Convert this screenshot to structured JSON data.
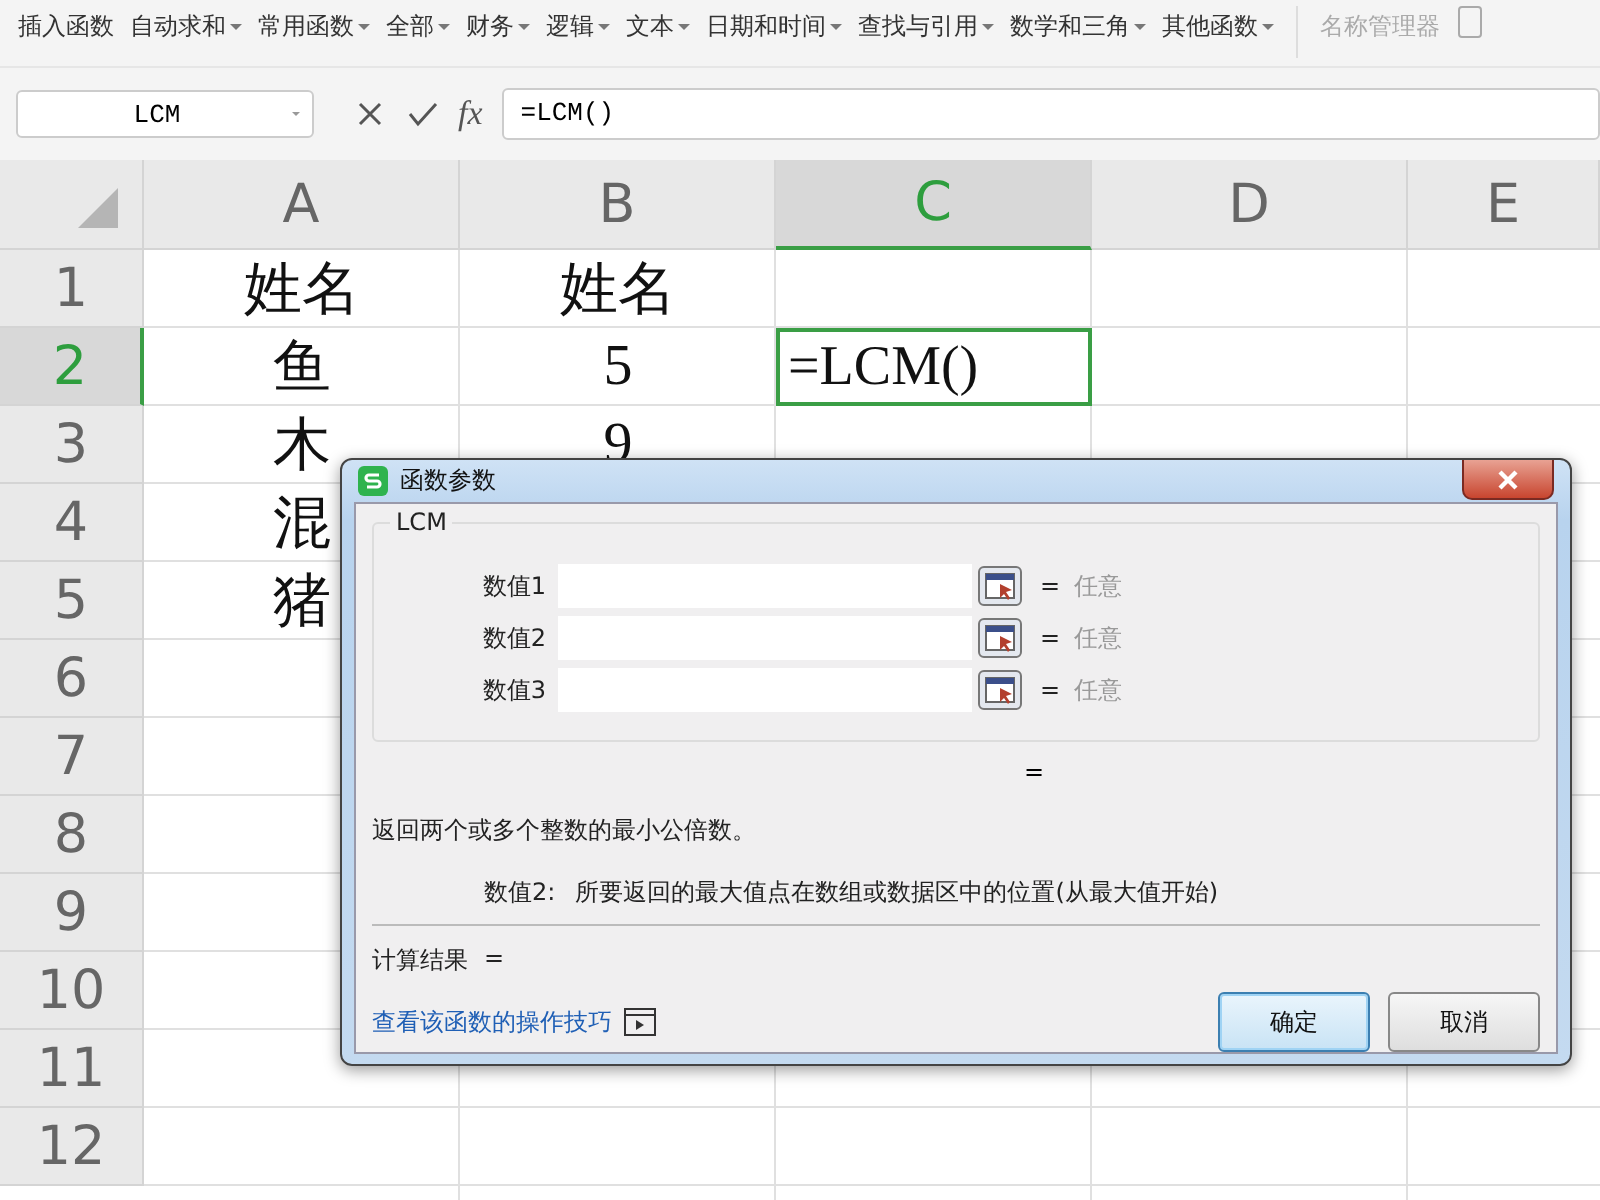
{
  "toolbar": {
    "items": [
      {
        "label": "插入函数",
        "has_menu": false,
        "disabled": false
      },
      {
        "label": "自动求和",
        "has_menu": true,
        "disabled": false
      },
      {
        "label": "常用函数",
        "has_menu": true,
        "disabled": false
      },
      {
        "label": "全部",
        "has_menu": true,
        "disabled": false
      },
      {
        "label": "财务",
        "has_menu": true,
        "disabled": false
      },
      {
        "label": "逻辑",
        "has_menu": true,
        "disabled": false
      },
      {
        "label": "文本",
        "has_menu": true,
        "disabled": false
      },
      {
        "label": "日期和时间",
        "has_menu": true,
        "disabled": false
      },
      {
        "label": "查找与引用",
        "has_menu": true,
        "disabled": false
      },
      {
        "label": "数学和三角",
        "has_menu": true,
        "disabled": false
      },
      {
        "label": "其他函数",
        "has_menu": true,
        "disabled": false
      },
      {
        "label": "名称管理器",
        "has_menu": false,
        "disabled": true
      }
    ]
  },
  "formula_bar": {
    "name_box": "LCM",
    "fx": "fx",
    "formula": "=LCM()"
  },
  "sheet": {
    "columns": [
      {
        "label": "A",
        "selected": false
      },
      {
        "label": "B",
        "selected": false
      },
      {
        "label": "C",
        "selected": true
      },
      {
        "label": "D",
        "selected": false
      },
      {
        "label": "E",
        "selected": false
      }
    ],
    "rows": [
      {
        "label": "1",
        "selected": false,
        "cells": [
          {
            "text": "姓名",
            "kind": "text",
            "selected": false
          },
          {
            "text": "姓名",
            "kind": "text",
            "selected": false
          }
        ]
      },
      {
        "label": "2",
        "selected": true,
        "cells": [
          {
            "text": "鱼",
            "kind": "text",
            "selected": false
          },
          {
            "text": "5",
            "kind": "text",
            "selected": false
          },
          {
            "text": "=LCM()",
            "kind": "formula",
            "selected": true
          }
        ]
      },
      {
        "label": "3",
        "selected": false,
        "cells": [
          {
            "text": "木",
            "kind": "text",
            "selected": false
          },
          {
            "text": "9",
            "kind": "text",
            "selected": false
          }
        ]
      },
      {
        "label": "4",
        "selected": false,
        "cells": [
          {
            "text": "混",
            "kind": "text",
            "selected": false
          }
        ]
      },
      {
        "label": "5",
        "selected": false,
        "cells": [
          {
            "text": "猪",
            "kind": "text",
            "selected": false
          }
        ]
      },
      {
        "label": "6",
        "selected": false
      },
      {
        "label": "7",
        "selected": false
      },
      {
        "label": "8",
        "selected": false
      },
      {
        "label": "9",
        "selected": false
      },
      {
        "label": "10",
        "selected": false
      },
      {
        "label": "11",
        "selected": false
      },
      {
        "label": "12",
        "selected": false
      }
    ]
  },
  "dialog": {
    "title": "函数参数",
    "function_name": "LCM",
    "arguments": [
      {
        "label": "数值1",
        "equals": "=",
        "hint": "任意"
      },
      {
        "label": "数值2",
        "equals": "=",
        "hint": "任意"
      },
      {
        "label": "数值3",
        "equals": "=",
        "hint": "任意"
      }
    ],
    "result_equals": "=",
    "description": "返回两个或多个整数的最小公倍数。",
    "argument_help": {
      "label": "数值2:",
      "text": "所要返回的最大值点在数组或数据区中的位置(从最大值开始)"
    },
    "calc_result": {
      "label": "计算结果",
      "equals": "="
    },
    "help_link": "查看该函数的操作技巧",
    "buttons": [
      {
        "label": "确定",
        "default": true
      },
      {
        "label": "取消",
        "default": false
      }
    ]
  }
}
